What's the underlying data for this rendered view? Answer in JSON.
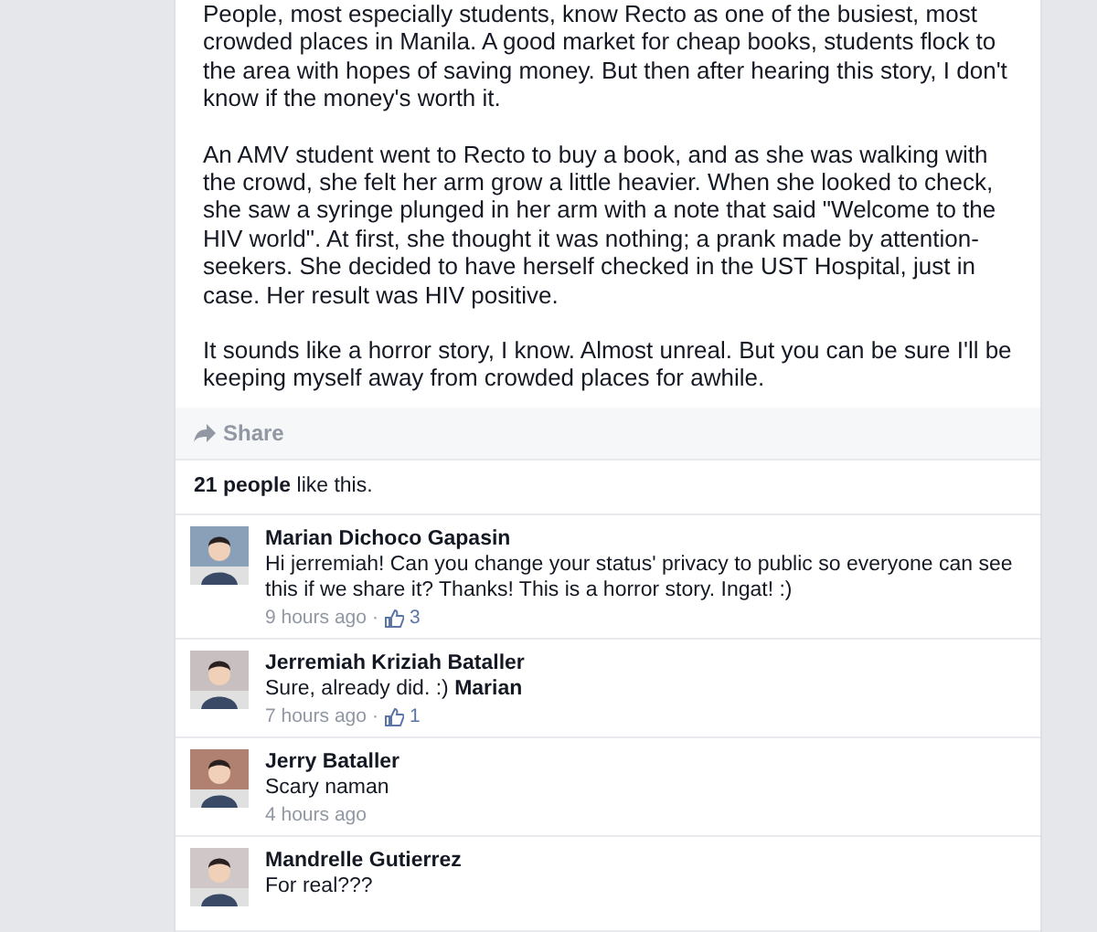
{
  "post": {
    "paragraphs": [
      "People, most especially students, know Recto as one of the busiest, most crowded places in Manila. A good market for cheap books, students flock to the area with hopes of saving money. But then after hearing this story, I don't know if the money's worth it.",
      "An AMV student went to Recto to buy a book, and as she was walking with the crowd, she felt her arm grow a little heavier. When she looked to check, she saw a syringe plunged in her arm with a note that said \"Welcome to the HIV world\". At first, she thought it was nothing; a prank made by attention-seekers. She decided to have herself checked in the UST Hospital, just in case. Her result was HIV positive.",
      "It sounds like a horror story, I know. Almost unreal. But you can be sure I'll be keeping myself away from crowded places for awhile."
    ],
    "share": "Share"
  },
  "likes": "**21 people** like this.",
  "comments": [
    {
      "author": "Marian Dichoco Gapasin",
      "text": "Hi jerremiah! Can you change your status' privacy to public so everyone can see this if we share it? Thanks! This is a horror story. Ingat! :)",
      "time": "9 hours ago",
      "separator": "·",
      "like_count": "3"
    },
    {
      "author": "Jerremiah Kriziah Bataller",
      "text": "Sure, already did. :) **Marian**",
      "time": "7 hours ago",
      "separator": "·",
      "like_count": "1"
    },
    {
      "author": "Jerry Bataller",
      "text": "Scary naman",
      "time": "4 hours ago"
    },
    {
      "author": "Mandrelle Gutierrez",
      "text": "For real???"
    }
  ]
}
